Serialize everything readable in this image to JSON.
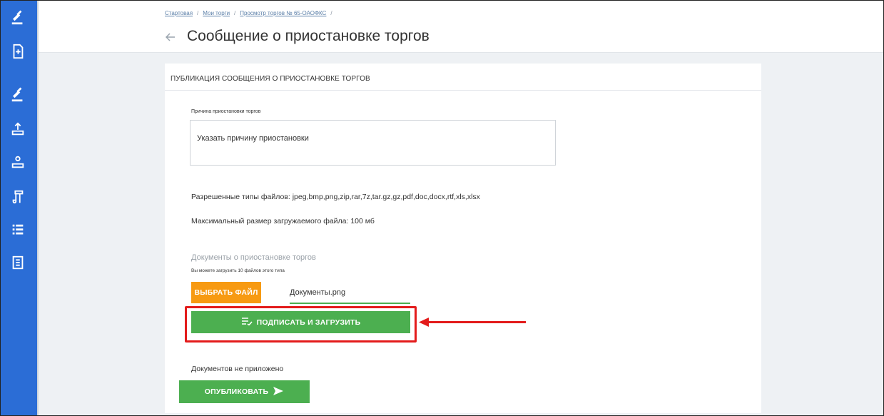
{
  "breadcrumb": {
    "items": [
      "Стартовая",
      "Мои торги",
      "Просмотр торгов № 65-ОАОФКС"
    ],
    "separator": "/"
  },
  "header": {
    "back_icon": "back-arrow-icon",
    "title": "Сообщение о приостановке торгов"
  },
  "sidebar": {
    "icons": [
      "gavel-icon",
      "document-add-icon",
      "gavel-icon",
      "user-upload-icon",
      "user-download-icon",
      "scroll-icon",
      "list-icon",
      "contacts-icon"
    ]
  },
  "card": {
    "title": "ПУБЛИКАЦИЯ СООБЩЕНИЯ О ПРИОСТАНОВКЕ ТОРГОВ",
    "reason_label": "Причина приостановки торгов",
    "reason_value": "Указать причину приостановки",
    "allowed_types": "Разрешенные типы файлов: jpeg,bmp,png,zip,rar,7z,tar.gz,gz,pdf,doc,docx,rtf,xls,xlsx",
    "max_size": "Максимальный размер загружаемого файла: 100 мб",
    "docs_heading": "Документы о приостановке торгов",
    "docs_hint": "Вы можете загрузить 10 файлов этого типа",
    "choose_file_label": "ВЫБРАТЬ ФАЙЛ",
    "file_name": "Документы.png",
    "sign_upload_label": "ПОДПИСАТЬ И ЗАГРУЗИТЬ",
    "no_docs_text": "Документов не приложено",
    "publish_label": "ОПУБЛИКОВАТЬ"
  },
  "colors": {
    "sidebar": "#2b6dd6",
    "primary_green": "#4caf50",
    "accent_orange": "#f79a12",
    "highlight_red": "#e31b1b"
  }
}
